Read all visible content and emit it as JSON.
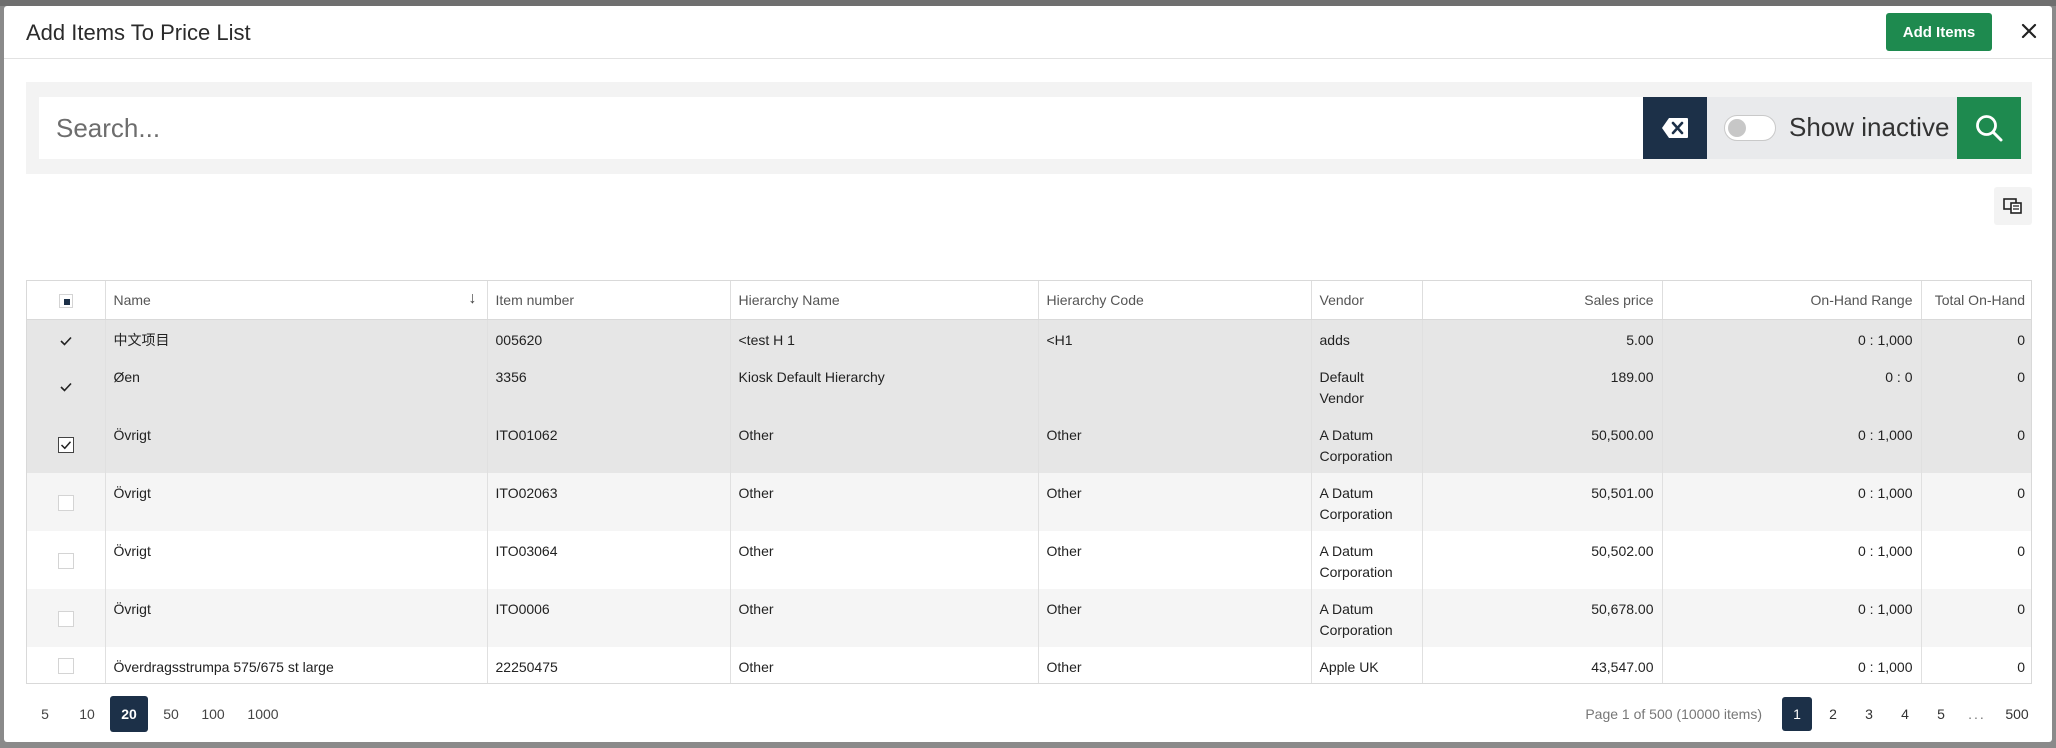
{
  "dialog": {
    "title": "Add Items To Price List",
    "add_button": "Add Items",
    "close_icon": "close-icon"
  },
  "search": {
    "placeholder": "Search...",
    "value": "",
    "show_inactive_label": "Show inactive",
    "show_inactive": false
  },
  "table": {
    "columns": {
      "name": "Name",
      "item_number": "Item number",
      "hierarchy_name": "Hierarchy Name",
      "hierarchy_code": "Hierarchy Code",
      "vendor": "Vendor",
      "sales_price": "Sales price",
      "on_hand_range": "On-Hand Range",
      "total_on_hand": "Total On-Hand"
    },
    "sort_indicator": "↓",
    "rows": [
      {
        "selected": true,
        "name": "中文项目",
        "item_number": "005620",
        "hierarchy_name": "<test H 1",
        "hierarchy_code": "<H1",
        "vendor_l1": "adds",
        "vendor_l2": "",
        "sales_price": "5.00",
        "on_hand_range": "0 : 1,000",
        "total_on_hand": "0"
      },
      {
        "selected": true,
        "name": "Øen",
        "item_number": "3356",
        "hierarchy_name": "Kiosk Default Hierarchy",
        "hierarchy_code": "",
        "vendor_l1": "Default",
        "vendor_l2": "Vendor",
        "sales_price": "189.00",
        "on_hand_range": "0 : 0",
        "total_on_hand": "0"
      },
      {
        "selected": true,
        "name": "Övrigt",
        "item_number": "ITO01062",
        "hierarchy_name": "Other",
        "hierarchy_code": "Other",
        "vendor_l1": "A Datum",
        "vendor_l2": "Corporation",
        "sales_price": "50,500.00",
        "on_hand_range": "0 : 1,000",
        "total_on_hand": "0"
      },
      {
        "selected": false,
        "name": "Övrigt",
        "item_number": "ITO02063",
        "hierarchy_name": "Other",
        "hierarchy_code": "Other",
        "vendor_l1": "A Datum",
        "vendor_l2": "Corporation",
        "sales_price": "50,501.00",
        "on_hand_range": "0 : 1,000",
        "total_on_hand": "0"
      },
      {
        "selected": false,
        "name": "Övrigt",
        "item_number": "ITO03064",
        "hierarchy_name": "Other",
        "hierarchy_code": "Other",
        "vendor_l1": "A Datum",
        "vendor_l2": "Corporation",
        "sales_price": "50,502.00",
        "on_hand_range": "0 : 1,000",
        "total_on_hand": "0"
      },
      {
        "selected": false,
        "name": "Övrigt",
        "item_number": "ITO0006",
        "hierarchy_name": "Other",
        "hierarchy_code": "Other",
        "vendor_l1": "A Datum",
        "vendor_l2": "Corporation",
        "sales_price": "50,678.00",
        "on_hand_range": "0 : 1,000",
        "total_on_hand": "0"
      },
      {
        "selected": false,
        "name": "Överdragsstrumpa 575/675 st large",
        "item_number": "22250475",
        "hierarchy_name": "Other",
        "hierarchy_code": "Other",
        "vendor_l1": "Apple UK",
        "vendor_l2": "",
        "sales_price": "43,547.00",
        "on_hand_range": "0 : 1,000",
        "total_on_hand": "0"
      }
    ]
  },
  "pager": {
    "page_sizes": [
      "5",
      "10",
      "20",
      "50",
      "100",
      "1000"
    ],
    "active_page_size": "20",
    "page_info": "Page 1 of 500 (10000 items)",
    "pages": [
      "1",
      "2",
      "3",
      "4",
      "5"
    ],
    "ellipsis": "...",
    "last_page": "500",
    "current_page": "1"
  },
  "colors": {
    "accent_green": "#1e8a4f",
    "navy": "#1c3048"
  }
}
